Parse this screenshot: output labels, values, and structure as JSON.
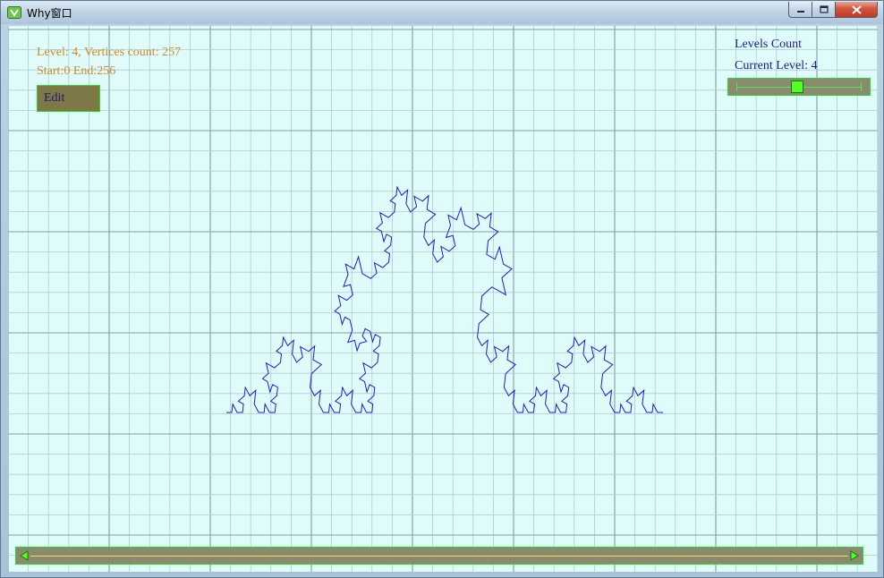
{
  "window": {
    "title": "Why窗口",
    "icon": "app-icon",
    "controls": [
      "minimize-icon",
      "maximize-icon",
      "close-icon"
    ]
  },
  "info": {
    "level_line": "Level: 4, Vertices count: 257",
    "range_line": "Start:0 End:256"
  },
  "toolbar": {
    "edit_label": "Edit"
  },
  "levels": {
    "count_label": "Levels Count",
    "current_label": "Current Level: 4",
    "slider_level_fraction": 0.48
  },
  "scrollbar": {
    "left_icon": "left-arrow-icon",
    "right_icon": "right-arrow-icon"
  },
  "colors": {
    "background": "#e0fcfa",
    "grid_minor": "#a9cfd0",
    "grid_major": "#7f9f9f",
    "curve": "#1c1cd0",
    "info_text": "#d08a2a",
    "label_text": "#1a1a9a",
    "control_border": "#22dd22",
    "control_fill": "#8a8a6e",
    "thumb": "#55ff22"
  }
}
